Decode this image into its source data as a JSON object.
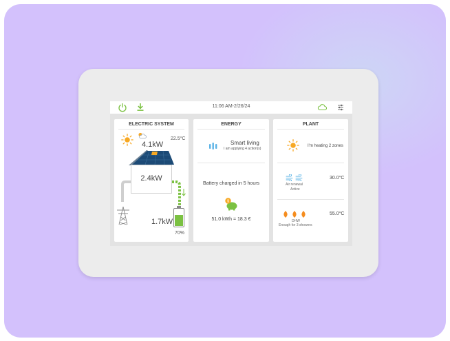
{
  "topbar": {
    "time": "11:06 AM-2/26/24",
    "icons": [
      "power-icon",
      "download-icon",
      "cloud-icon",
      "settings-sliders-icon"
    ]
  },
  "electric_system": {
    "title": "ELECTRIC SYSTEM",
    "solar_power": "4.1kW",
    "outside_temp": "22.5°C",
    "house_power": "2.4kW",
    "battery_power": "1.7kW",
    "battery_level": "70%",
    "battery_fill_fraction": 0.7
  },
  "energy": {
    "title": "ENERGY",
    "smart_title": "Smart living",
    "smart_subtitle": "I am applying 4 action(s)",
    "battery_status": "Battery charged in 5 hours",
    "savings": "51.0 kWh = 18.3 €"
  },
  "plant": {
    "title": "PLANT",
    "heating_status": "I'm heating 2 zones",
    "air_label": "Air renewal",
    "air_status": "Active",
    "air_temp": "30.0°C",
    "dhw_label": "DHW",
    "dhw_status": "Enough for 3 showers",
    "dhw_temp": "55.0°C"
  },
  "colors": {
    "accent_green": "#7bc142",
    "sun_orange": "#f7a823",
    "flame_orange": "#f58d1f",
    "air_blue": "#5bb3e6",
    "background_purple": "#d3c1fc"
  }
}
